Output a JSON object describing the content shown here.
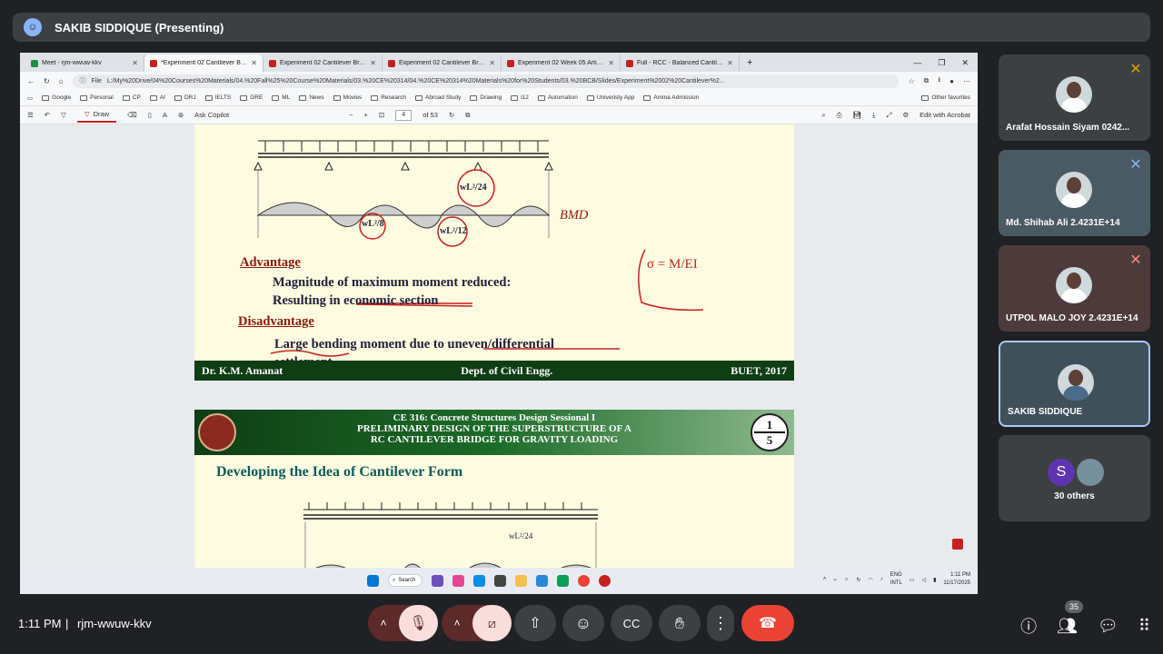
{
  "meet": {
    "presenter_title": "SAKIB SIDDIQUE (Presenting)",
    "time": "1:11 PM",
    "separator": "|",
    "meeting_code": "rjm-wwuw-kkv",
    "participant_count": "35"
  },
  "browser": {
    "tabs": [
      {
        "label": "Meet - rjm-wwuw-kkv"
      },
      {
        "label": "*Experiment 02 Cantilever Bridge"
      },
      {
        "label": "Experiment 02 Cantilever Bridge"
      },
      {
        "label": "Experiment 02 Cantilever Bridge"
      },
      {
        "label": "Experiment 02 Week 05 Articulat"
      },
      {
        "label": "Full - RCC - Balanced Cantilever B"
      }
    ],
    "url_prefix": "File",
    "url": "L:/My%20Drive/04%20Courses%20Materials/04.%20Fall%25%20Course%20Materials/03.%20CE%20314/04.%20CE%20314%20Materials%20for%20Students/03.%20BCB/Slides/Experiment%2002%20Cantilever%2...",
    "bookmarks": [
      "Google",
      "Personal",
      "CP",
      "AI",
      "DRJ",
      "IELTS",
      "GRE",
      "ML",
      "News",
      "Movies",
      "Research",
      "Abroad Study",
      "Drawing",
      "i12",
      "Automation",
      "Univeristy App",
      "Amina Admission"
    ],
    "other_favorites": "Other favorites"
  },
  "pdf_toolbar": {
    "draw_label": "Draw",
    "copilot_label": "Ask Copilot",
    "page_current": "4",
    "page_total": "of 53",
    "edit_label": "Edit with Acrobat"
  },
  "slide1": {
    "bmd_label": "BMD",
    "moment_wl2_24": "wL²/24",
    "moment_wl2_8": "wL²/8",
    "moment_wl2_12": "wL²/12",
    "advantage_heading": "Advantage",
    "advantage_line1": "Magnitude of maximum moment reduced:",
    "advantage_line2": "Resulting in economic section",
    "disadvantage_heading": "Disadvantage",
    "disadvantage_line1": "Large bending moment due to uneven/differential",
    "disadvantage_line2": "settlement",
    "footer_left": "Dr. K.M. Amanat",
    "footer_center": "Dept. of Civil Engg.",
    "footer_right": "BUET, 2017",
    "annotation": "σ = M/EI"
  },
  "slide2": {
    "header_line1": "CE 316: Concrete Structures Design Sessional I",
    "header_line2": "PRELIMINARY DESIGN OF THE SUPERSTRUCTURE OF A",
    "header_line3": "RC CANTILEVER BRIDGE FOR GRAVITY LOADING",
    "badge_top": "1",
    "badge_bottom": "5",
    "title": "Developing the Idea of Cantilever Form",
    "moment_label": "wL²/24"
  },
  "taskbar": {
    "search": "Search",
    "lang1": "ENG",
    "lang2": "INTL",
    "clock_time": "1:11 PM",
    "clock_date": "11/17/2025"
  },
  "participants": [
    {
      "name": "Arafat Hossain Siyam 0242..."
    },
    {
      "name": "Md. Shihab Ali 2.4231E+14"
    },
    {
      "name": "UTPOL MALO JOY 2.4231E+14"
    },
    {
      "name": "SAKIB SIDDIQUE"
    }
  ],
  "others": {
    "initial": "S",
    "label": "30 others"
  },
  "colors": {
    "end_call": "#ea4335",
    "mic_off_bg": "#5c2b29",
    "mic_off_pink": "#f9dedc",
    "meet_bg": "#202124"
  }
}
